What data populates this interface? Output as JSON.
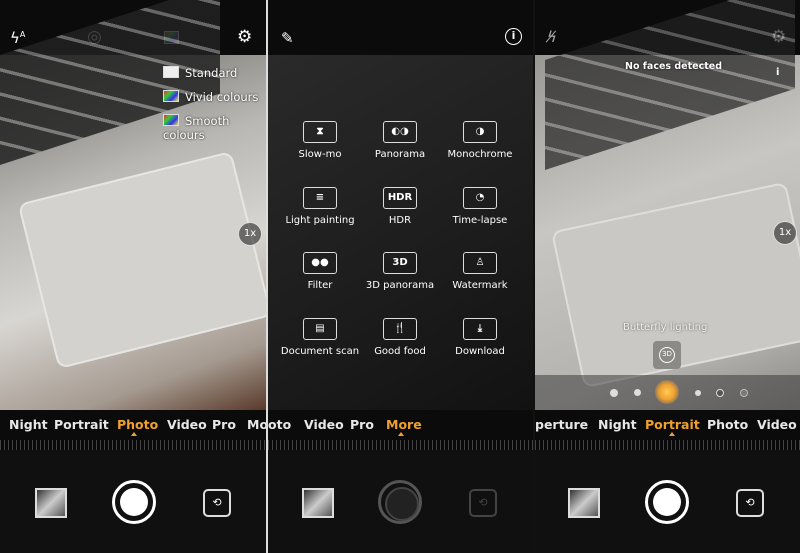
{
  "panel1": {
    "top_icons": [
      "flash-auto-icon",
      "aperture-icon",
      "filter-icon",
      "settings-icon"
    ],
    "filter_menu": [
      "Standard",
      "Vivid colours",
      "Smooth colours"
    ],
    "zoom_label": "1x",
    "modes": [
      "Night",
      "Portrait",
      "Photo",
      "Video",
      "Pro",
      "Mo"
    ],
    "active_mode": "Photo"
  },
  "panel2": {
    "top_icons": [
      "edit-icon",
      "info-icon"
    ],
    "items": [
      {
        "label": "Slow-mo",
        "icon": "⧗"
      },
      {
        "label": "Panorama",
        "icon": "◐◑"
      },
      {
        "label": "Monochrome",
        "icon": "◑"
      },
      {
        "label": "Light painting",
        "icon": "≡"
      },
      {
        "label": "HDR",
        "icon": "HDR"
      },
      {
        "label": "Time-lapse",
        "icon": "◔"
      },
      {
        "label": "Filter",
        "icon": "●●"
      },
      {
        "label": "3D panorama",
        "icon": "3D"
      },
      {
        "label": "Watermark",
        "icon": "♙"
      },
      {
        "label": "Document scan",
        "icon": "▤"
      },
      {
        "label": "Good food",
        "icon": "🍴"
      },
      {
        "label": "Download",
        "icon": "⤓"
      }
    ],
    "modes": [
      "oto",
      "Video",
      "Pro",
      "More"
    ],
    "active_mode": "More"
  },
  "panel3": {
    "top_icons": [
      "flash-off-icon",
      "settings-icon"
    ],
    "status": "No faces detected",
    "info_label": "i",
    "zoom_label": "1x",
    "lighting_label": "Butterfly lighting",
    "lighting_icon_label": "3D",
    "modes": [
      "perture",
      "Night",
      "Portrait",
      "Photo",
      "Video"
    ],
    "active_mode": "Portrait"
  },
  "colors": {
    "accent": "#f0a030"
  }
}
